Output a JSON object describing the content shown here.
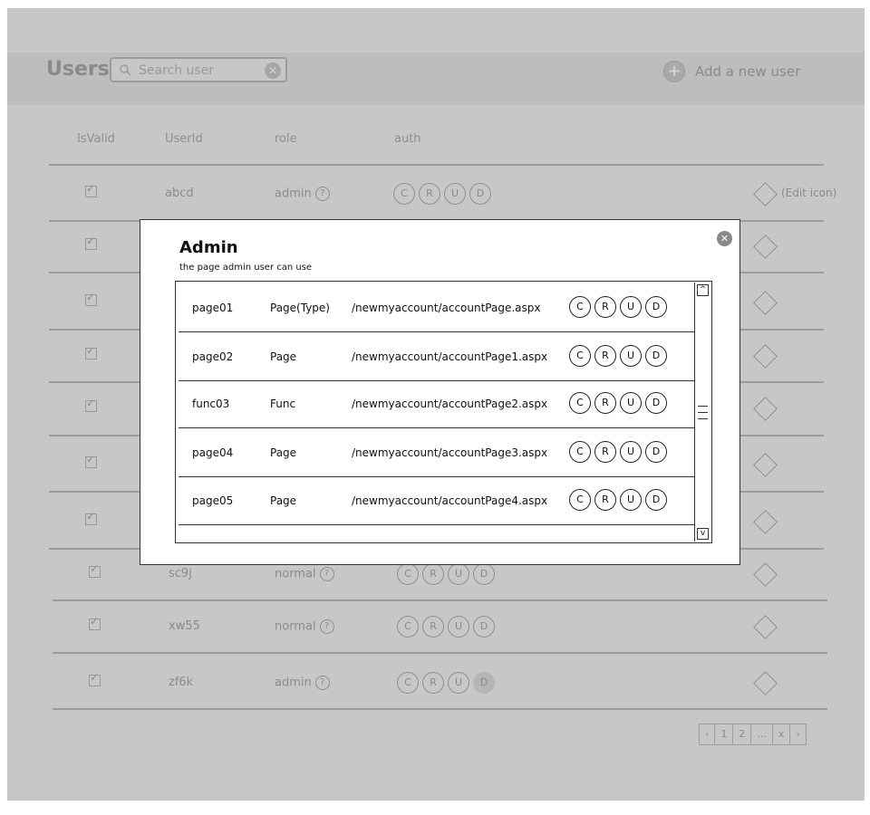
{
  "header": {
    "title": "Users",
    "search_placeholder": "Search user",
    "add_user_label": "Add a new user"
  },
  "table": {
    "columns": [
      "IsValid",
      "UserId",
      "role",
      "auth"
    ],
    "rows": [
      {
        "user_id": "abcd",
        "role": "admin",
        "crud": [
          "C",
          "R",
          "U",
          "D"
        ],
        "disabled": [],
        "edit_note": "(Edit icon)"
      },
      {
        "user_id": "",
        "role": "",
        "crud": [],
        "disabled": [],
        "edit_note": ""
      },
      {
        "user_id": "",
        "role": "",
        "crud": [],
        "disabled": [],
        "edit_note": ""
      },
      {
        "user_id": "",
        "role": "",
        "crud": [],
        "disabled": [],
        "edit_note": ""
      },
      {
        "user_id": "",
        "role": "",
        "crud": [],
        "disabled": [],
        "edit_note": ""
      },
      {
        "user_id": "",
        "role": "",
        "crud": [],
        "disabled": [],
        "edit_note": ""
      },
      {
        "user_id": "",
        "role": "",
        "crud": [],
        "disabled": [],
        "edit_note": ""
      },
      {
        "user_id": "sc9j",
        "role": "normal",
        "crud": [
          "C",
          "R",
          "U",
          "D"
        ],
        "disabled": [],
        "edit_note": ""
      },
      {
        "user_id": "xw55",
        "role": "normal",
        "crud": [
          "C",
          "R",
          "U",
          "D"
        ],
        "disabled": [],
        "edit_note": ""
      },
      {
        "user_id": "zf6k",
        "role": "admin",
        "crud": [
          "C",
          "R",
          "U",
          "D"
        ],
        "disabled": [
          "D"
        ],
        "edit_note": ""
      }
    ]
  },
  "pagination": [
    "‹",
    "1",
    "2",
    "...",
    "x",
    "›"
  ],
  "modal": {
    "title": "Admin",
    "subtitle": "the page admin user can use",
    "close_glyph": "✕",
    "rows": [
      {
        "id": "page01",
        "type": "Page(Type)",
        "path": "/newmyaccount/accountPage.aspx",
        "crud": [
          "C",
          "R",
          "U",
          "D"
        ]
      },
      {
        "id": "page02",
        "type": "Page",
        "path": "/newmyaccount/accountPage1.aspx",
        "crud": [
          "C",
          "R",
          "U",
          "D"
        ]
      },
      {
        "id": "func03",
        "type": "Func",
        "path": "/newmyaccount/accountPage2.aspx",
        "crud": [
          "C",
          "R",
          "U",
          "D"
        ]
      },
      {
        "id": "page04",
        "type": "Page",
        "path": "/newmyaccount/accountPage3.aspx",
        "crud": [
          "C",
          "R",
          "U",
          "D"
        ]
      },
      {
        "id": "page05",
        "type": "Page",
        "path": "/newmyaccount/accountPage4.aspx",
        "crud": [
          "C",
          "R",
          "U",
          "D"
        ]
      }
    ]
  },
  "colors": {
    "overlay_gray": "#c7c7c7",
    "header_gray": "#bdbdbd",
    "modal_bg": "#ffffff",
    "ink": "#111111"
  },
  "icons": {
    "search": "search-icon",
    "clear": "clear-icon",
    "add": "plus-circle-icon",
    "help": "question-icon",
    "edit": "diamond-edit-icon",
    "close": "close-icon"
  }
}
